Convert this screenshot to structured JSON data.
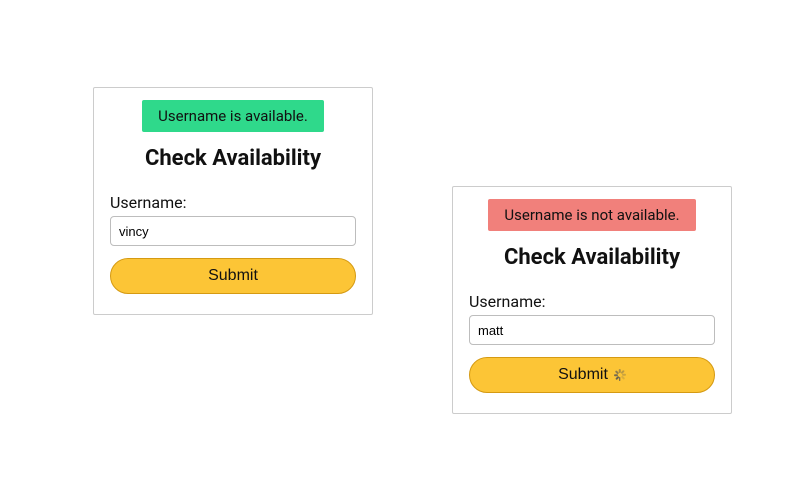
{
  "forms": {
    "left": {
      "status_text": "Username is available.",
      "status_kind": "available",
      "title": "Check Availability",
      "username_label": "Username:",
      "username_value": "vincy",
      "submit_label": "Submit",
      "loading": false
    },
    "right": {
      "status_text": "Username is not available.",
      "status_kind": "unavailable",
      "title": "Check Availability",
      "username_label": "Username:",
      "username_value": "matt",
      "submit_label": "Submit",
      "loading": true
    }
  },
  "colors": {
    "available_bg": "#2fd98b",
    "unavailable_bg": "#f1807b",
    "button_bg": "#fcc536",
    "button_border": "#d59a12"
  }
}
